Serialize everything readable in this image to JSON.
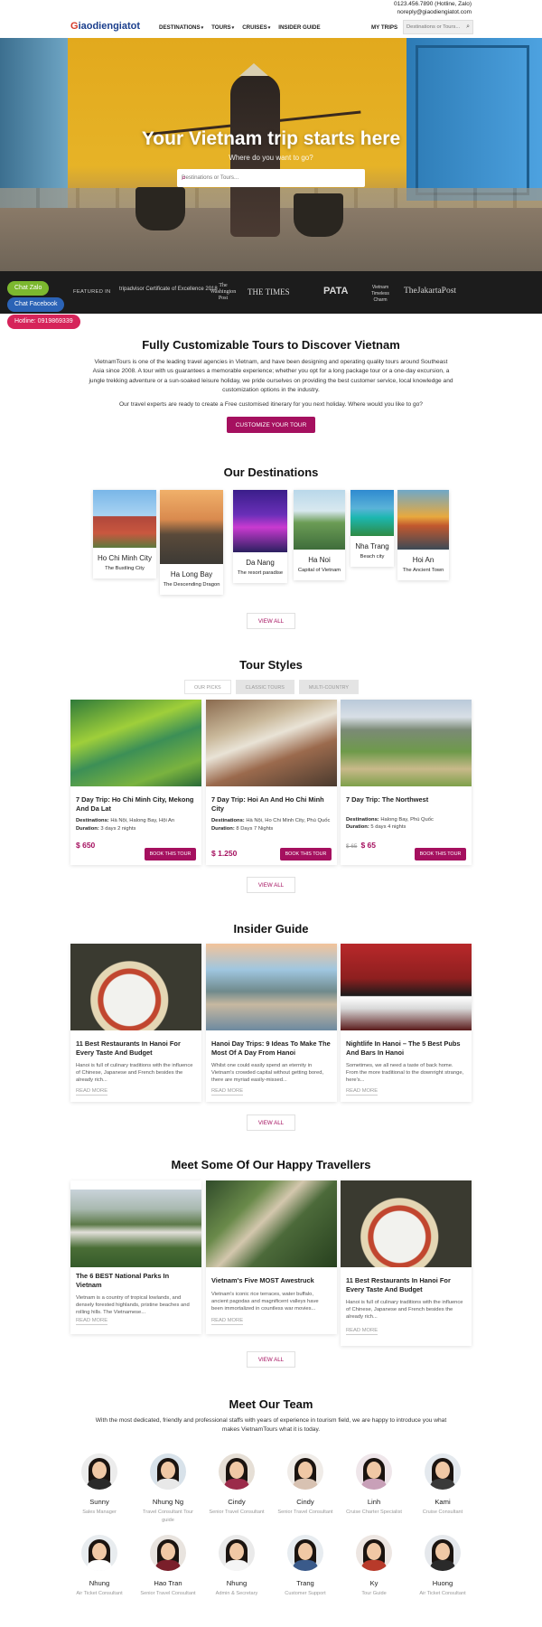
{
  "topbar": {
    "phone": "0123.456.7890 (Hotline, Zalo)",
    "email": "noreply@giaodiengiatot.com"
  },
  "header": {
    "logo_g": "G",
    "logo_rest": "iaodiengiatot",
    "nav": [
      {
        "label": "DESTINATIONS",
        "dropdown": true
      },
      {
        "label": "TOURS",
        "dropdown": true
      },
      {
        "label": "CRUISES",
        "dropdown": true
      },
      {
        "label": "INSIDER GUIDE",
        "dropdown": false
      }
    ],
    "my_trips": "MY TRIPS",
    "search_placeholder": "Destinations or Tours..."
  },
  "hero": {
    "title": "Your Vietnam trip starts here",
    "subtitle": "Where do you want to go?",
    "search_placeholder": "Destinations or Tours..."
  },
  "featured": {
    "label": "FEATURED IN",
    "logos": [
      "tripadvisor Certificate of Excellence 2018",
      "The Washington Post",
      "THE TIMES",
      "PATA",
      "Vietnam Timeless Charm",
      "TheJakartaPost"
    ]
  },
  "chat": {
    "zalo": "Chat Zalo",
    "facebook": "Chat Facebook",
    "hotline": "Hotline: 0919869339"
  },
  "intro": {
    "heading": "Fully Customizable Tours to Discover Vietnam",
    "p1": "VietnamTours is one of the leading travel agencies in Vietnam, and have been designing and operating quality tours around Southeast Asia since 2008. A tour with us guarantees a memorable experience; whether you opt for a long package tour or a one-day excursion, a jungle trekking adventure or a sun-soaked leisure holiday, we pride ourselves on providing the best customer service, local knowledge and customization options in the industry.",
    "p2": "Our travel experts are ready to create a Free customised itinerary for you next holiday. Where would you like to go?",
    "cta": "CUSTOMIZE YOUR TOUR"
  },
  "destinations": {
    "heading": "Our Destinations",
    "items": [
      {
        "name": "Ho Chi Minh City",
        "tag": "The Bustling City"
      },
      {
        "name": "Ha Long Bay",
        "tag": "The Descending Dragon"
      },
      {
        "name": "Da Nang",
        "tag": "The resort paradise"
      },
      {
        "name": "Ha Noi",
        "tag": "Capital of Vietnam"
      },
      {
        "name": "Nha Trang",
        "tag": "Beach city"
      },
      {
        "name": "Hoi An",
        "tag": "The Ancient Town"
      }
    ],
    "view_all": "VIEW ALL"
  },
  "tour_styles": {
    "heading": "Tour Styles",
    "tabs": [
      "OUR PICKS",
      "CLASSIC TOURS",
      "MULTI-COUNTRY"
    ],
    "dest_label": "Destinations:",
    "dur_label": "Duration:",
    "book": "BOOK THIS TOUR",
    "tours": [
      {
        "title": "7 Day Trip: Ho Chi Minh City, Mekong And Da Lat",
        "destinations": "Hà Nội, Halong Bay, Hội An",
        "duration": "3 days 2 nights",
        "old_price": "",
        "price": "$ 650"
      },
      {
        "title": "7 Day Trip: Hoi An And Ho Chi Minh City",
        "destinations": "Hà Nội, Ho Chi Minh City, Phú Quốc",
        "duration": "8 Days 7 Nights",
        "old_price": "",
        "price": "$ 1.250"
      },
      {
        "title": "7 Day Trip: The Northwest",
        "destinations": "Halong Bay, Phú Quốc",
        "duration": "5 days 4 nights",
        "old_price": "$ 65",
        "price": "$ 65"
      }
    ],
    "view_all": "VIEW ALL"
  },
  "insider": {
    "heading": "Insider Guide",
    "read_more": "READ MORE",
    "posts": [
      {
        "title": "11 Best Restaurants In Hanoi For Every Taste And Budget",
        "excerpt": "Hanoi is full of culinary traditions with the influence of Chinese, Japanese and French besides the already rich..."
      },
      {
        "title": "Hanoi Day Trips: 9 Ideas To Make The Most Of A Day From Hanoi",
        "excerpt": "Whilst one could easily spend an eternity in Vietnam's crowded capital without getting bored, there are myriad easily-missed..."
      },
      {
        "title": "Nightlife In Hanoi – The 5 Best Pubs And Bars In Hanoi",
        "excerpt": "Sometimes, we all need a taste of back home. From the more traditional to the downright strange, here's..."
      }
    ],
    "view_all": "VIEW ALL"
  },
  "travellers": {
    "heading": "Meet Some Of Our Happy Travellers",
    "read_more": "READ MORE",
    "posts": [
      {
        "title": "The 6 BEST National Parks In Vietnam",
        "excerpt": "Vietnam is a country of tropical lowlands, and densely forested highlands, pristine beaches and rolling hills. The Vietnamese..."
      },
      {
        "title": "Vietnam's Five MOST Awestruck",
        "excerpt": "Vietnam's iconic rice terraces, water buffalo, ancient pagodas and magnificent valleys have been immortalized in countless war movies..."
      },
      {
        "title": "11 Best Restaurants In Hanoi For Every Taste And Budget",
        "excerpt": "Hanoi is full of culinary traditions with the influence of Chinese, Japanese and French besides the already rich..."
      }
    ],
    "view_all": "VIEW ALL"
  },
  "team": {
    "heading": "Meet Our Team",
    "intro": "With the most dedicated, friendly and professional staffs with years of experience in tourism field, we are happy to introduce you what makes VietnamTours what it is today.",
    "members": [
      {
        "name": "Sunny",
        "role": "Sales Manager"
      },
      {
        "name": "Nhung Ng",
        "role": "Travel Consultant Tour guide"
      },
      {
        "name": "Cindy",
        "role": "Senior Travel Consultant"
      },
      {
        "name": "Cindy",
        "role": "Senior Travel Consultant"
      },
      {
        "name": "Linh",
        "role": "Cruise Charter Specialist"
      },
      {
        "name": "Kami",
        "role": "Cruise Consultant"
      },
      {
        "name": "Nhung",
        "role": "Air Ticket Consultant"
      },
      {
        "name": "Hao Tran",
        "role": "Senior Travel Consultant"
      },
      {
        "name": "Nhung",
        "role": "Admin & Secretary"
      },
      {
        "name": "Trang",
        "role": "Customer Support"
      },
      {
        "name": "Ky",
        "role": "Tour Guide"
      },
      {
        "name": "Huong",
        "role": "Air Ticket Consultant"
      }
    ]
  },
  "colors": {
    "accent": "#a5105f",
    "zalo": "#7cb82f",
    "facebook": "#2b63b6",
    "hotline": "#d6245a"
  }
}
